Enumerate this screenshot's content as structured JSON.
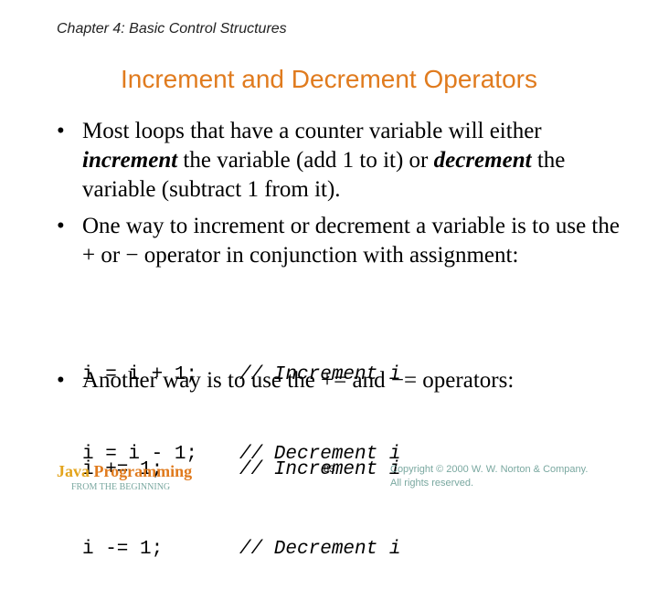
{
  "header": {
    "chapter": "Chapter 4: Basic Control Structures",
    "title": "Increment and Decrement Operators"
  },
  "bullets": [
    {
      "parts": [
        "Most loops that have a counter variable will either ",
        "increment",
        " the variable (add 1 to it) or ",
        "decrement",
        " the variable (subtract 1 from it)."
      ]
    },
    {
      "text": "One way to increment or decrement a variable is to use the + or − operator in conjunction with assignment:"
    },
    {
      "text": "Another way is to use the += and −= operators:"
    }
  ],
  "code_blocks": [
    [
      {
        "stmt": "i = i + 1;",
        "comment": "// Increment i"
      },
      {
        "stmt": "i = i - 1;",
        "comment": "// Decrement i"
      }
    ],
    [
      {
        "stmt": "i += 1;",
        "comment": "// Increment i"
      },
      {
        "stmt": "i -= 1;",
        "comment": "// Decrement i"
      }
    ]
  ],
  "footer": {
    "brand_java": "Java",
    "brand_programming": "Programming",
    "brand_sub": "FROM THE BEGINNING",
    "page_number": "83",
    "copyright_line1": "Copyright © 2000 W. W. Norton & Company.",
    "copyright_line2": "All rights reserved."
  }
}
